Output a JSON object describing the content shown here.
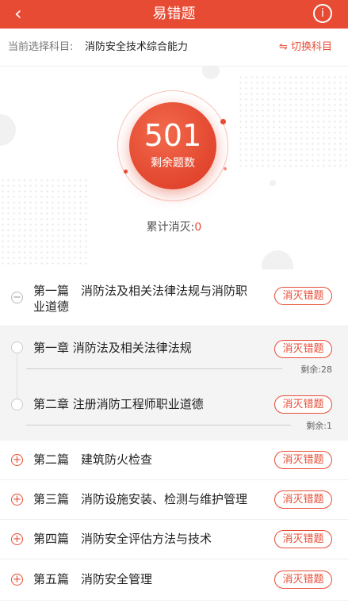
{
  "header": {
    "title": "易错题"
  },
  "subject": {
    "label": "当前选择科目:",
    "value": "消防安全技术综合能力",
    "switch_label": "⇋ 切换科目"
  },
  "stats": {
    "remaining_count": "501",
    "remaining_label": "剩余题数",
    "cumulative_label": "累计消灭:",
    "cumulative_value": "0"
  },
  "button_label": "消灭错题",
  "sections": [
    {
      "title_line1": "第一篇　消防法及相关法律法规与消防职",
      "title_line2": "业道德",
      "expanded": true,
      "chapters": [
        {
          "title": "第一章 消防法及相关法律法规",
          "remaining": "剩余:28"
        },
        {
          "title": "第二章 注册消防工程师职业道德",
          "remaining": "剩余:1"
        }
      ]
    },
    {
      "title": "第二篇　建筑防火检查"
    },
    {
      "title": "第三篇　消防设施安装、检测与维护管理"
    },
    {
      "title": "第四篇　消防安全评估方法与技术"
    },
    {
      "title": "第五篇　消防安全管理"
    }
  ],
  "colors": {
    "accent": "#e84b34"
  }
}
